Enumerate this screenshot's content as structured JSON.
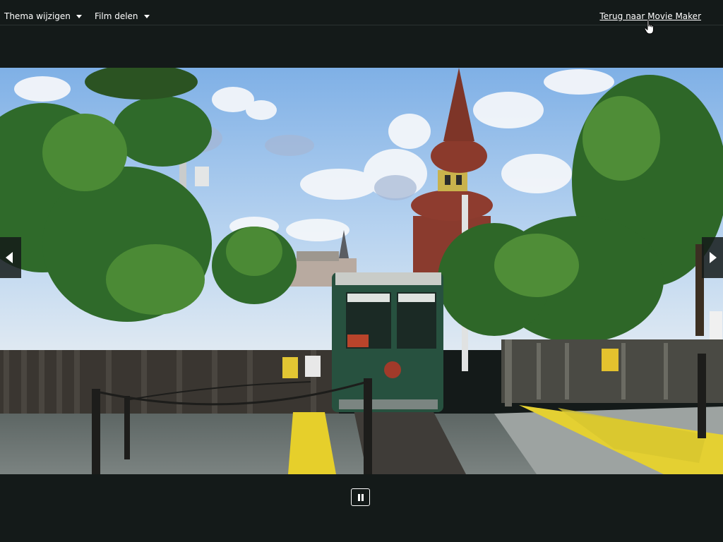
{
  "topbar": {
    "theme_menu": {
      "label": "Thema wijzigen",
      "icon": "caret-down-icon"
    },
    "share_menu": {
      "label": "Film delen",
      "icon": "caret-down-icon"
    },
    "back_link": {
      "label": "Terug naar Movie Maker"
    }
  },
  "player": {
    "scene": "Green funicular train arriving at a station platform with a wooden fence, trees and a church spire under a cloudy blue sky",
    "prev_icon": "arrow-left-icon",
    "next_icon": "arrow-right-icon",
    "pause_icon": "pause-icon",
    "pause_label": "Pause"
  },
  "colors": {
    "background": "#141a19",
    "text": "#ffffff"
  }
}
